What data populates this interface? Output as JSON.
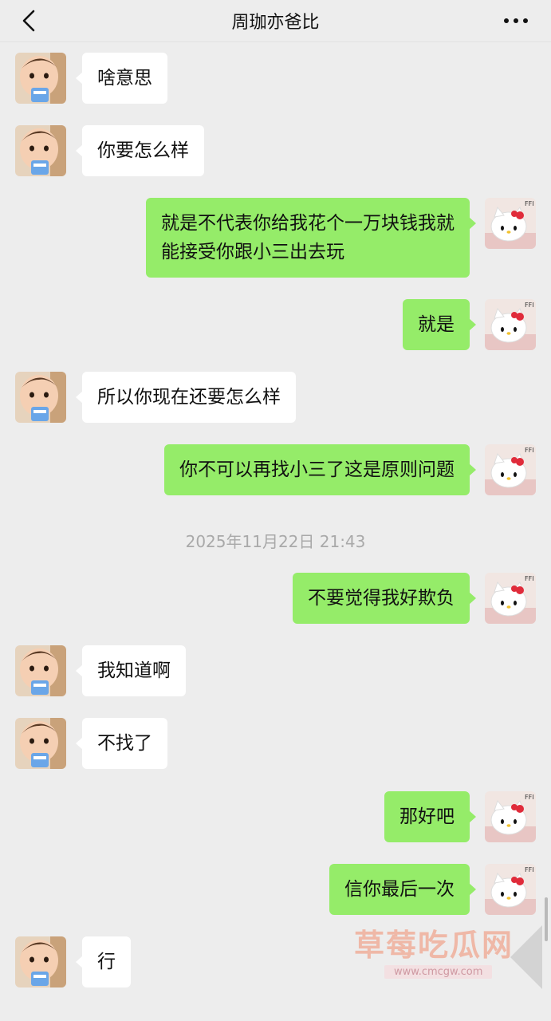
{
  "header": {
    "title": "周珈亦爸比",
    "back_icon": "chevron-left-icon",
    "more_icon": "more-dots-icon"
  },
  "messages": [
    {
      "side": "in",
      "text": "啥意思"
    },
    {
      "side": "in",
      "text": "你要怎么样"
    },
    {
      "side": "out",
      "text": "就是不代表你给我花个一万块钱我就\n能接受你跟小三出去玩"
    },
    {
      "side": "out",
      "text": "就是"
    },
    {
      "side": "in",
      "text": "所以你现在还要怎么样"
    },
    {
      "side": "out",
      "text": "你不可以再找小三了这是原则问题"
    },
    {
      "side": "out",
      "text": "不要觉得我好欺负"
    },
    {
      "side": "in",
      "text": "我知道啊"
    },
    {
      "side": "in",
      "text": "不找了"
    },
    {
      "side": "out",
      "text": "那好吧"
    },
    {
      "side": "out",
      "text": "信你最后一次"
    },
    {
      "side": "in",
      "text": "行"
    }
  ],
  "timestamp": "2025年11月22日 21:43",
  "watermark": {
    "text": "草莓吃瓜网",
    "url": "www.cmcgw.com"
  },
  "avatars": {
    "contact": "baby-avatar",
    "self": "hello-kitty-avatar",
    "self_badge": "FFI"
  },
  "colors": {
    "background": "#ededed",
    "bubble_out": "#95ec69",
    "bubble_in": "#ffffff"
  }
}
